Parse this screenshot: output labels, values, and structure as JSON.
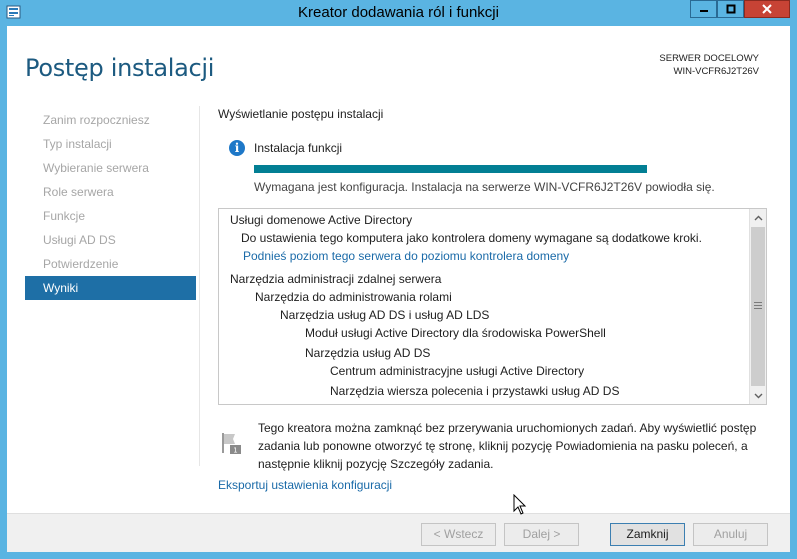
{
  "window": {
    "title": "Kreator dodawania ról i funkcji"
  },
  "header": {
    "page_title": "Postęp instalacji",
    "dest_label": "SERWER DOCELOWY",
    "dest_server": "WIN-VCFR6J2T26V"
  },
  "nav": {
    "items": [
      {
        "label": "Zanim rozpoczniesz",
        "active": false
      },
      {
        "label": "Typ instalacji",
        "active": false
      },
      {
        "label": "Wybieranie serwera",
        "active": false
      },
      {
        "label": "Role serwera",
        "active": false
      },
      {
        "label": "Funkcje",
        "active": false
      },
      {
        "label": "Usługi AD DS",
        "active": false
      },
      {
        "label": "Potwierdzenie",
        "active": false
      },
      {
        "label": "Wyniki",
        "active": true
      }
    ]
  },
  "main": {
    "section_header": "Wyświetlanie postępu instalacji",
    "status_label": "Instalacja funkcji",
    "progress": 1.0,
    "progress_message": "Wymagana jest konfiguracja. Instalacja na serwerze WIN-VCFR6J2T26V powiodła się.",
    "results": [
      {
        "text": "Usługi domenowe Active Directory",
        "indent": 0,
        "link": false
      },
      {
        "text": "Do ustawienia tego komputera jako kontrolera domeny wymagane są dodatkowe kroki.",
        "indent": 1,
        "link": false
      },
      {
        "text": "Podnieś poziom tego serwera do poziomu kontrolera domeny",
        "indent": 1,
        "link": true
      },
      {
        "text": "Narzędzia administracji zdalnej serwera",
        "indent": 0,
        "link": false
      },
      {
        "text": "Narzędzia do administrowania rolami",
        "indent": 1,
        "link": false
      },
      {
        "text": "Narzędzia usług AD DS i usług AD LDS",
        "indent": 2,
        "link": false
      },
      {
        "text": "Moduł usługi Active Directory dla środowiska PowerShell",
        "indent": 3,
        "link": false
      },
      {
        "text": "Narzędzia usług AD DS",
        "indent": 3,
        "link": false
      },
      {
        "text": "Centrum administracyjne usługi Active Directory",
        "indent": 4,
        "link": false
      },
      {
        "text": "Narzędzia wiersza polecenia i przystawki usług AD DS",
        "indent": 4,
        "link": false
      }
    ],
    "note": "Tego kreatora można zamknąć bez przerywania uruchomionych zadań. Aby wyświetlić postęp zadania lub ponowne otworzyć tę stronę, kliknij pozycję Powiadomienia na pasku poleceń, a następnie kliknij pozycję Szczegóły zadania.",
    "export_link": "Eksportuj ustawienia konfiguracji"
  },
  "footer": {
    "prev": "< Wstecz",
    "next": "Dalej >",
    "close": "Zamknij",
    "cancel": "Anuluj"
  },
  "colors": {
    "title_blue": "#1c5a80",
    "nav_active": "#1e6fa6",
    "progress": "#027f94",
    "link": "#1a6aa8",
    "window_chrome": "#5ab4e2"
  }
}
